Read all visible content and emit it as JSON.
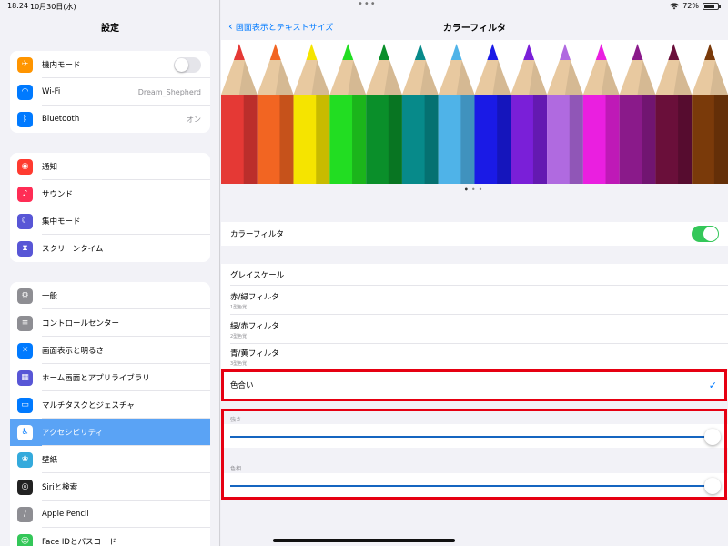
{
  "status": {
    "time": "18:24",
    "date": "10月30日(水)",
    "battery": "72%"
  },
  "sidebar": {
    "title": "設定",
    "groups": [
      [
        {
          "label": "機内モード",
          "icon": "airplane-icon",
          "color": "#ff9500"
        },
        {
          "label": "Wi-Fi",
          "icon": "wifi-icon",
          "color": "#007aff",
          "value": "Dream_Shepherd"
        },
        {
          "label": "Bluetooth",
          "icon": "bluetooth-icon",
          "color": "#007aff",
          "value": "オン"
        }
      ],
      [
        {
          "label": "通知",
          "icon": "notification-icon",
          "color": "#ff3b30"
        },
        {
          "label": "サウンド",
          "icon": "sound-icon",
          "color": "#ff2d55"
        },
        {
          "label": "集中モード",
          "icon": "moon-icon",
          "color": "#5856d6"
        },
        {
          "label": "スクリーンタイム",
          "icon": "hourglass-icon",
          "color": "#5856d6"
        }
      ],
      [
        {
          "label": "一般",
          "icon": "gear-icon",
          "color": "#8e8e93"
        },
        {
          "label": "コントロールセンター",
          "icon": "control-center-icon",
          "color": "#8e8e93"
        },
        {
          "label": "画面表示と明るさ",
          "icon": "brightness-icon",
          "color": "#007aff"
        },
        {
          "label": "ホーム画面とアプリライブラリ",
          "icon": "home-screen-icon",
          "color": "#5856d6"
        },
        {
          "label": "マルチタスクとジェスチャ",
          "icon": "multitask-icon",
          "color": "#007aff"
        },
        {
          "label": "アクセシビリティ",
          "icon": "accessibility-icon",
          "color": "#007aff"
        },
        {
          "label": "壁紙",
          "icon": "wallpaper-icon",
          "color": "#34aadc"
        },
        {
          "label": "Siriと検索",
          "icon": "siri-icon",
          "color": "#222222"
        },
        {
          "label": "Apple Pencil",
          "icon": "pencil-icon",
          "color": "#8e8e93"
        },
        {
          "label": "Face IDとパスコード",
          "icon": "face-id-icon",
          "color": "#34c759"
        }
      ]
    ]
  },
  "main": {
    "back_label": "画面表示とテキストサイズ",
    "title": "カラーフィルタ",
    "color_filter_label": "カラーフィルタ",
    "filters": [
      {
        "label": "グレイスケール",
        "sub": ""
      },
      {
        "label": "赤/緑フィルタ",
        "sub": "1型色覚"
      },
      {
        "label": "緑/赤フィルタ",
        "sub": "2型色覚"
      },
      {
        "label": "青/黄フィルタ",
        "sub": "3型色覚"
      }
    ],
    "tint_label": "色合い",
    "intensity_label": "強さ",
    "hue_label": "色相",
    "intensity_value": 1.0,
    "hue_value": 1.0,
    "pencil_colors": [
      "#e53935",
      "#f26522",
      "#f5e400",
      "#22dd22",
      "#0a8f2a",
      "#078a8a",
      "#4fb3e8",
      "#1a1ae6",
      "#7a1fd8",
      "#b06ae0",
      "#ea1fe0",
      "#8a1a8a",
      "#6a0f3a",
      "#7a3a0a"
    ],
    "accent_color": "#007aff",
    "toggle_color": "#34c759",
    "highlight_color": "#e60012"
  }
}
